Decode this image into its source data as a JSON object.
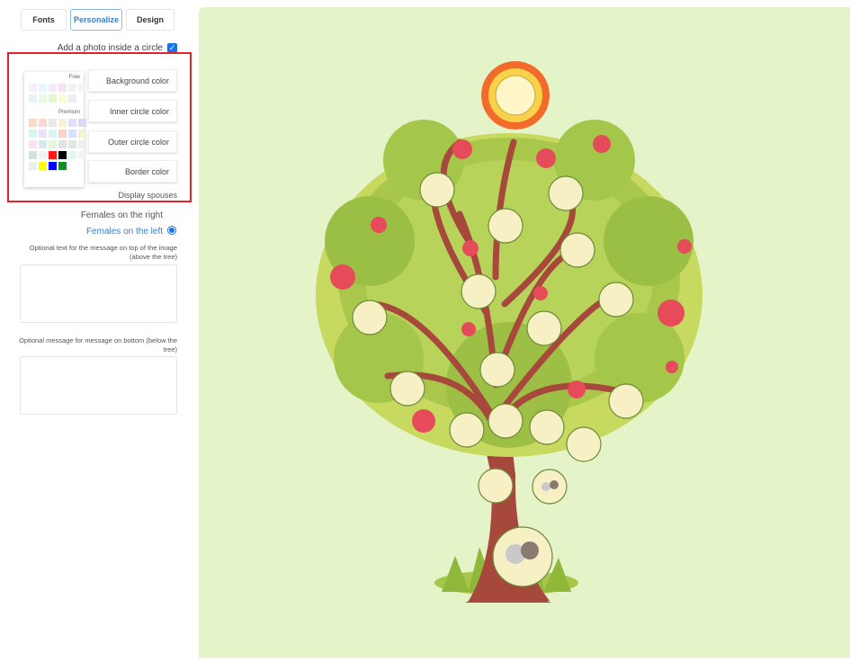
{
  "tabs": [
    {
      "label": "Fonts",
      "active": false
    },
    {
      "label": "Personalize",
      "active": true
    },
    {
      "label": "Design",
      "active": false
    }
  ],
  "photo_option": {
    "label": "Add a photo inside a circle",
    "checked": true
  },
  "palette": {
    "free_label": "Free",
    "premium_label": "Premium",
    "free_colors": [
      "#f6eef8",
      "#e4f6fb",
      "#f3eafd",
      "#f9e2ef",
      "#eef3f5",
      "#f0f3f7",
      "#e9f2fb",
      "#e4fbe4",
      "#e4f7cf",
      "#fcfccf",
      "#eeeeee"
    ],
    "premium_colors": [
      "#fad9cb",
      "#fbd7d7",
      "#e9e9e9",
      "#fbefd9",
      "#e3dcfd",
      "#d8daf8",
      "#d8f5ea",
      "#eae1fb",
      "#d9f4f1",
      "#fdd3c9",
      "#d8e0fb",
      "#eff2d5",
      "#f9e1f7",
      "#d5ebeb",
      "#e6f5e2",
      "#e2e2e2",
      "#dfe8e2",
      "#eeeeee",
      "#d3e2db",
      "#f2f2f2",
      "#ff1a1a",
      "#000000",
      "#e5f5f3",
      "#f2f2f2",
      "#e8f0e8",
      "#ffff00",
      "#0000ff",
      "#0f8f2a"
    ]
  },
  "color_options": [
    "Background color",
    "Inner circle color",
    "Outer circle color",
    "Border color"
  ],
  "display_spouses": "Display spouses",
  "females_right": "Females on the right",
  "females_left": "Females on the left",
  "top_message_hint": "Optional text for the message on top of the image (above the tree)",
  "bottom_message_hint": "Optional message for message on bottom (below the tree)",
  "top_message_value": "",
  "bottom_message_value": "",
  "canvas": {
    "background": "#e4f4c8"
  },
  "colors": {
    "highlight_box": "#e2232a",
    "accent": "#3a7fc1",
    "checkbox": "#1a73e8"
  }
}
